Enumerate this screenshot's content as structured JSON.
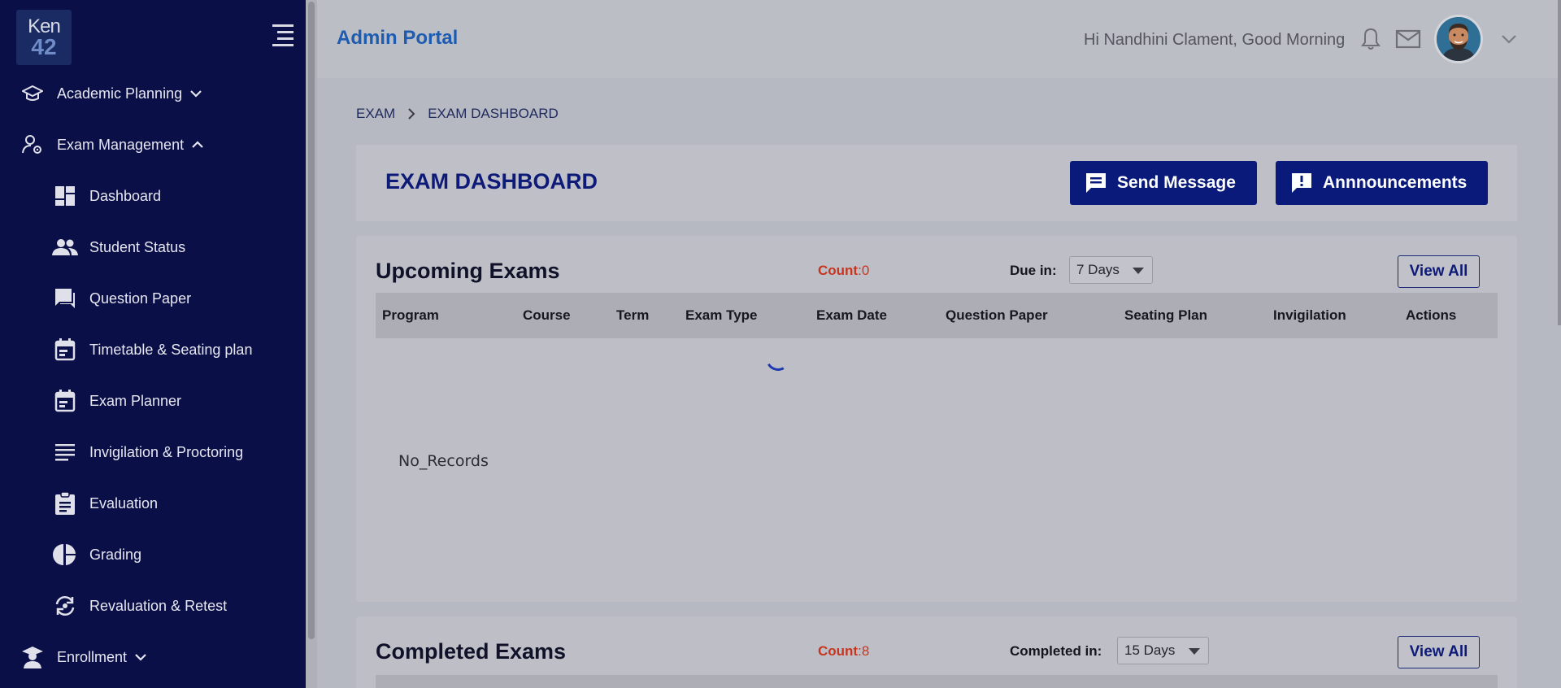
{
  "logo": {
    "line1": "Ken",
    "line2": "42"
  },
  "sidebar": {
    "items": [
      {
        "label": "Academic Planning",
        "icon": "graduation-cap-icon",
        "expanded": false
      },
      {
        "label": "Exam Management",
        "icon": "user-gear-icon",
        "expanded": true
      },
      {
        "label": "Dashboard",
        "icon": "dashboard-icon"
      },
      {
        "label": "Student Status",
        "icon": "people-icon"
      },
      {
        "label": "Question Paper",
        "icon": "chat-icon"
      },
      {
        "label": "Timetable & Seating plan",
        "icon": "calendar-icon"
      },
      {
        "label": "Exam Planner",
        "icon": "calendar-icon"
      },
      {
        "label": "Invigilation & Proctoring",
        "icon": "lines-icon"
      },
      {
        "label": "Evaluation",
        "icon": "clipboard-icon"
      },
      {
        "label": "Grading",
        "icon": "pie-chart-icon"
      },
      {
        "label": "Revaluation & Retest",
        "icon": "refresh-icon"
      },
      {
        "label": "Enrollment",
        "icon": "student-icon",
        "expanded": false
      }
    ]
  },
  "header": {
    "title": "Admin Portal",
    "greeting": "Hi Nandhini Clament, Good Morning"
  },
  "breadcrumb": {
    "items": [
      "EXAM",
      "EXAM DASHBOARD"
    ]
  },
  "page": {
    "title": "EXAM DASHBOARD",
    "send_message": "Send Message",
    "announcements": "Annnouncements"
  },
  "upcoming": {
    "title": "Upcoming Exams",
    "count_label": "Count",
    "count_value": ":0",
    "due_label": "Due in:",
    "due_value": "7 Days",
    "view_all": "View All",
    "columns": [
      "Program",
      "Course",
      "Term",
      "Exam Type",
      "Exam Date",
      "Question Paper",
      "Seating Plan",
      "Invigilation",
      "Actions"
    ],
    "empty_text": "No_Records"
  },
  "completed": {
    "title": "Completed Exams",
    "count_label": "Count",
    "count_value": ":8",
    "due_label": "Completed in:",
    "due_value": "15 Days",
    "view_all": "View All"
  },
  "colors": {
    "sidebar_bg": "#0b0f48",
    "primary": "#0a1a7a",
    "count": "#c8351f",
    "portal_title": "#1d5cb0"
  }
}
